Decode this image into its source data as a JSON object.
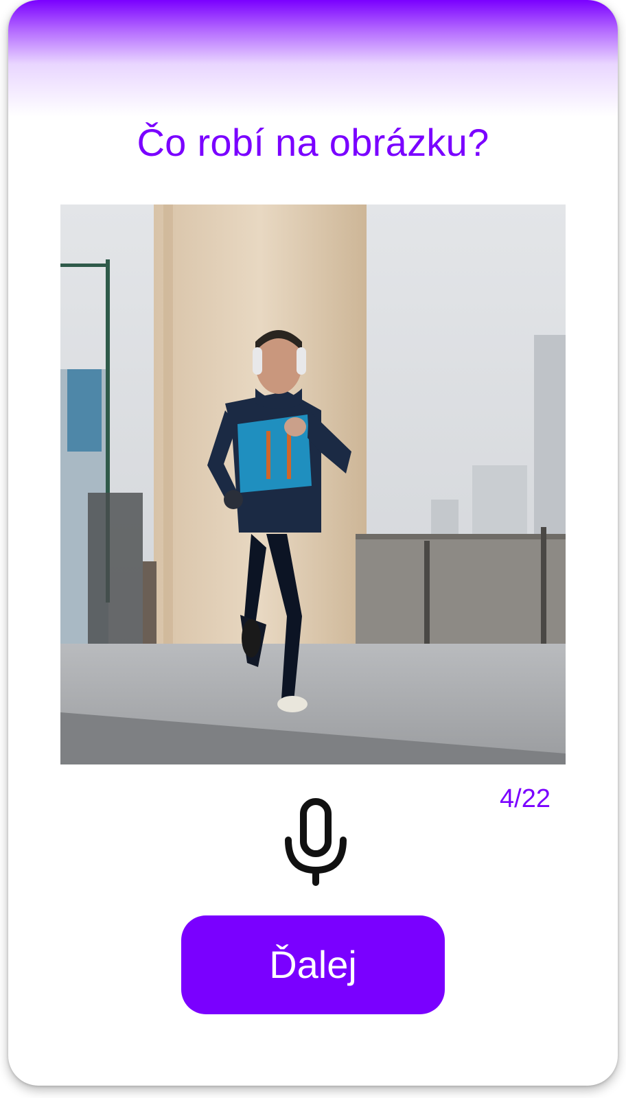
{
  "question": {
    "title": "Čo robí na obrázku?"
  },
  "image": {
    "icon": "photo-of-man-running-in-rain"
  },
  "progress": {
    "current": 4,
    "total": 22,
    "label": "4/22"
  },
  "microphone": {
    "icon": "microphone-icon"
  },
  "next_button": {
    "label": "Ďalej"
  },
  "colors": {
    "accent": "#7a00ff",
    "button_text": "#ffffff",
    "icon": "#111111"
  }
}
